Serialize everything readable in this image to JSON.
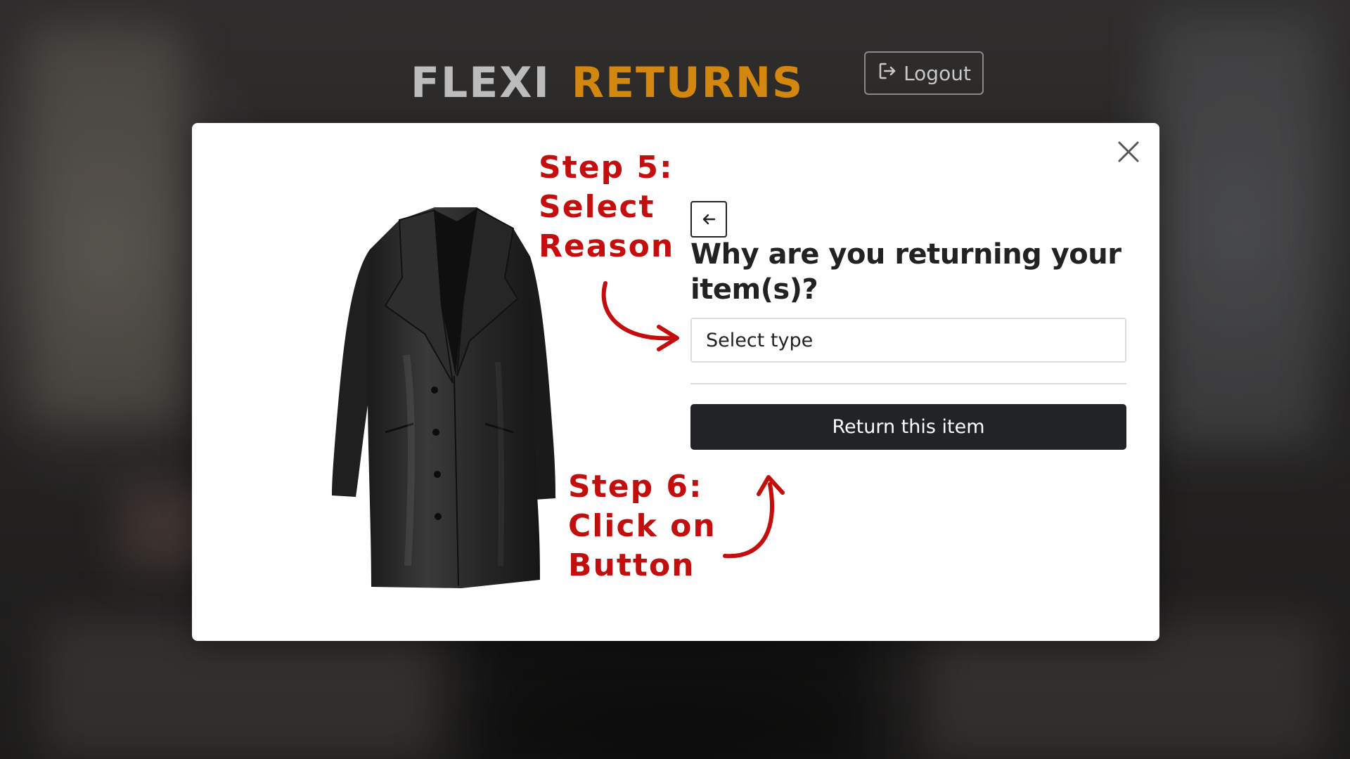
{
  "header": {
    "logo_part1": "FLEXI",
    "logo_part2": "RETURNS",
    "logout_label": "Logout"
  },
  "modal": {
    "question": "Why are you returning your item(s)?",
    "reason_select": {
      "placeholder": "Select type"
    },
    "return_button_label": "Return this item"
  },
  "annotations": {
    "step5": [
      "Step 5:",
      "Select",
      "Reason"
    ],
    "step6": [
      "Step 6:",
      "Click on",
      "Button"
    ]
  },
  "colors": {
    "logo_returns": "#d4870f",
    "annotation_red": "#c40d0d",
    "button_dark": "#212327"
  },
  "icons": {
    "logout": "logout-icon",
    "back": "arrow-left-icon",
    "close": "close-icon"
  }
}
